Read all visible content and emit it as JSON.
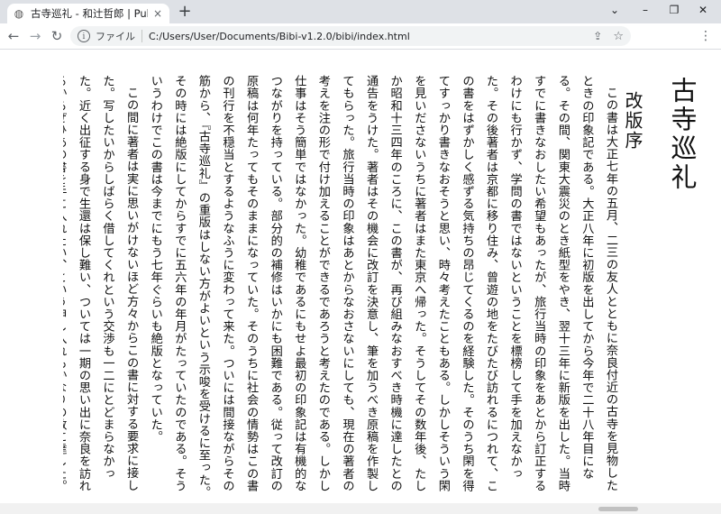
{
  "browser": {
    "tab_title": "古寺巡礼 - 和辻哲郎 | Published",
    "new_tab": "+",
    "close_tab": "×",
    "window_minimize": "⌄",
    "window_restore": "–",
    "window_max": "❐",
    "window_close": "✕",
    "nav_back": "←",
    "nav_forward": "→",
    "nav_reload": "↻",
    "scheme_label": "ファイル",
    "url": "C:/Users/User/Documents/Bibi-v1.2.0/bibi/index.html",
    "menu": "⋮"
  },
  "book": {
    "title": "古寺巡礼",
    "subtitle": "改版序",
    "paragraphs": [
      "この書は大正七年の五月、二三の友人とともに奈良付近の古寺を見物したときの印象記である。大正八年に初版を出してから今年で二十八年目になる。その間、関東大震災のとき紙型をやき、翌十三年に新版を出した。当時すでに書きなおしたい希望もあったが、旅行当時の印象をあとから訂正するわけにも行かず、学問の書ではないということを標榜して手を加えなかった。その後著者は京都に移り住み、曾遊の地をたびたび訪れるにつれて、この書をはずかしく感ずる気持ちの昂じてくるのを経験した。そのうち閑を得てすっかり書きなおそうと思い、時々考えたこともある。しかしそういう閑を見いださないうちに著者はまた東京へ帰った。そうしてその数年後、たしか昭和十三四年のころに、この書が、再び組みなおすべき時機に達したとの通告をうけた。著者はその機会に改訂を決意し、筆を加うべき原稿を作製してもらった。旅行当時の印象はあとからなおさないにしても、現在の著者の考えを注の形で付け加えることができるであろうと考えたのである。しかし仕事はそう簡単ではなかった。幼稚であるにもせよ最初の印象記は有機的なつながりを持っている。部分的の補修はいかにも困難である。従って改訂の原稿は何年たってもそのままになっていた。そのうちに社会の情勢はこの書の刊行を不穏当とするようなふうに変わって来た。ついには間接ながらその筋から、『古寺巡礼』の重版はしない方がよいという示唆を受けるに至った。その時には絶版にしてからすでに五六年の年月がたっていたのである。そういうわけでこの書は今までにもう七年ぐらいも絶版となっていた。",
      "この間に著者は実に思いがけないほど方々からこの書に対する要求に接した。写したいからしばらく借してくれという交渉も一二にとどまらなかった。近く出征する身で生還は保し難い、ついては一期の思い出に奈良を訪れるからぜひあの書を手に入れたい、という申し入れもかなりの数に達した。この書をはずかしく感じている著者はまったく途方に暮れざるを得なかった。かほどまでにこの書が愛されるということは著者にとって全くありがたいが、しかし一体それは何ゆえであろうか。著者がこの書を書いて以来、日本美術史の研究ははずっと進んでいるはずであるし、またその方面の著書も数多く現われている。この書がかつてつとめたような手引きの役目は、もう必要がなくなっていると思われる。著者自身も、もしそういう古美術の案内記をかくとすれば、すっかり内容の違ったものを作るであろう。つまりこの書は時勢おくれのものになっているはずなのである。にもかかわらずなおこの書が要求されるのは何ゆえであろうか。それを考えめぐらしているうちにふと思い当たったのは、この書のうちに今の著者がもはや持っていないもの、すなわち若さや情熱があ"
    ]
  }
}
